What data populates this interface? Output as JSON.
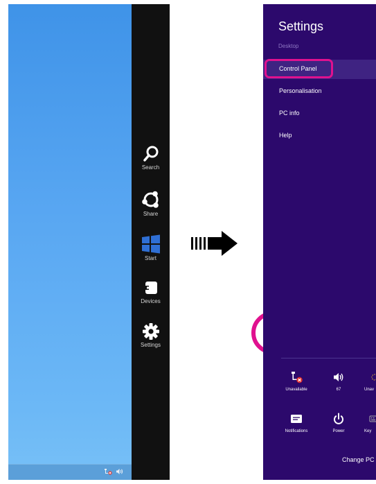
{
  "charms": {
    "search_label": "Search",
    "share_label": "Share",
    "start_label": "Start",
    "devices_label": "Devices",
    "settings_label": "Settings"
  },
  "settings_pane": {
    "title": "Settings",
    "context": "Desktop",
    "menu_items": [
      {
        "label": "Control Panel"
      },
      {
        "label": "Personalisation"
      },
      {
        "label": "PC info"
      },
      {
        "label": "Help"
      }
    ],
    "quick_settings": [
      {
        "label": "Unavailable",
        "icon": "network-unavailable-icon"
      },
      {
        "label": "67",
        "icon": "volume-icon"
      },
      {
        "label": "Unav",
        "icon": "brightness-icon"
      },
      {
        "label": "Notifications",
        "icon": "notifications-icon"
      },
      {
        "label": "Power",
        "icon": "power-icon"
      },
      {
        "label": "Key",
        "icon": "keyboard-icon"
      }
    ],
    "change_pc_settings": "Change PC"
  },
  "colors": {
    "highlight": "#e0118f",
    "pane_background": "#2c096c",
    "charm_bar": "#111111",
    "desktop_blue": "#59a7f2",
    "start_tile_blue": "#2f6fd4"
  }
}
